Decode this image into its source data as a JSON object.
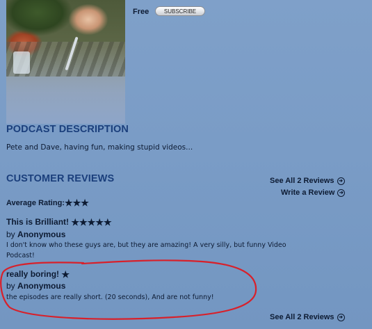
{
  "header": {
    "price": "Free",
    "subscribe_label": "SUBSCRIBE"
  },
  "description": {
    "title": "PODCAST DESCRIPTION",
    "text": "Pete and Dave, having fun, making stupid videos..."
  },
  "reviews": {
    "title": "CUSTOMER REVIEWS",
    "see_all_label": "See All 2 Reviews",
    "write_label": "Write a Review",
    "average_label": "Average Rating:",
    "average_stars": "★★★",
    "average_value": 3,
    "items": [
      {
        "title": "This is Brilliant!",
        "stars": "★★★★★",
        "rating": 5,
        "by_prefix": "by",
        "author": "Anonymous",
        "text_line1": "I don't know who these guys are, but they are amazing! A very silly, but funny Video",
        "text_line2": "Podcast!"
      },
      {
        "title": "really boring!",
        "stars": "★",
        "rating": 1,
        "by_prefix": "by",
        "author": "Anonymous",
        "text_line1": "the episodes are really short. (20 seconds), And are not funny!"
      }
    ],
    "see_all_bottom_label": "See All 2 Reviews"
  },
  "icons": {
    "arrow": "circled-right-arrow-icon",
    "arrow_glyph": "➔",
    "star": "star-icon"
  },
  "colors": {
    "background": "#7a9cc6",
    "heading": "#1b3f7c",
    "text": "#0d1b33",
    "annotation": "#d8202a"
  }
}
